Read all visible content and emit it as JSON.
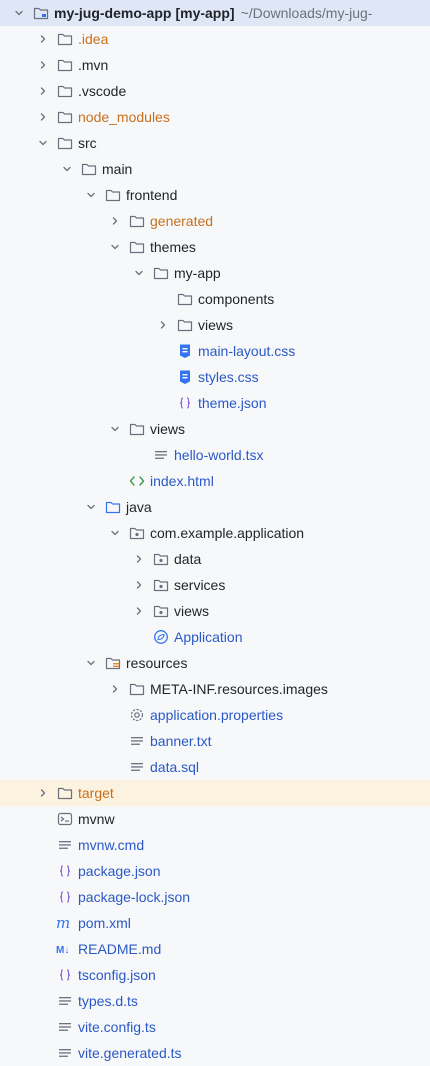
{
  "tree": {
    "rows": [
      {
        "label": "my-jug-demo-app",
        "tag": "[my-app]",
        "path": "~/Downloads/my-jug-",
        "kind": "module",
        "color": "dark",
        "depth": 0,
        "expand": "open",
        "selected": true
      },
      {
        "label": ".idea",
        "kind": "folder",
        "color": "orange",
        "depth": 1,
        "expand": "closed"
      },
      {
        "label": ".mvn",
        "kind": "folder",
        "color": "dark",
        "depth": 1,
        "expand": "closed"
      },
      {
        "label": ".vscode",
        "kind": "folder",
        "color": "dark",
        "depth": 1,
        "expand": "closed"
      },
      {
        "label": "node_modules",
        "kind": "folder",
        "color": "orange",
        "depth": 1,
        "expand": "closed"
      },
      {
        "label": "src",
        "kind": "folder",
        "color": "dark",
        "depth": 1,
        "expand": "open"
      },
      {
        "label": "main",
        "kind": "folder",
        "color": "dark",
        "depth": 2,
        "expand": "open"
      },
      {
        "label": "frontend",
        "kind": "folder",
        "color": "dark",
        "depth": 3,
        "expand": "open"
      },
      {
        "label": "generated",
        "kind": "folder",
        "color": "orange",
        "depth": 4,
        "expand": "closed"
      },
      {
        "label": "themes",
        "kind": "folder",
        "color": "dark",
        "depth": 4,
        "expand": "open"
      },
      {
        "label": "my-app",
        "kind": "folder",
        "color": "dark",
        "depth": 5,
        "expand": "open"
      },
      {
        "label": "components",
        "kind": "folder",
        "color": "dark",
        "depth": 6,
        "expand": "none"
      },
      {
        "label": "views",
        "kind": "folder",
        "color": "dark",
        "depth": 6,
        "expand": "closed"
      },
      {
        "label": "main-layout.css",
        "kind": "css",
        "color": "blue",
        "depth": 6,
        "expand": "none"
      },
      {
        "label": "styles.css",
        "kind": "css",
        "color": "blue",
        "depth": 6,
        "expand": "none"
      },
      {
        "label": "theme.json",
        "kind": "json",
        "color": "blue",
        "depth": 6,
        "expand": "none"
      },
      {
        "label": "views",
        "kind": "folder",
        "color": "dark",
        "depth": 4,
        "expand": "open"
      },
      {
        "label": "hello-world.tsx",
        "kind": "text",
        "color": "blue",
        "depth": 5,
        "expand": "none"
      },
      {
        "label": "index.html",
        "kind": "html",
        "color": "blue",
        "depth": 4,
        "expand": "none"
      },
      {
        "label": "java",
        "kind": "source-folder",
        "color": "dark",
        "depth": 3,
        "expand": "open"
      },
      {
        "label": "com.example.application",
        "kind": "package",
        "color": "dark",
        "depth": 4,
        "expand": "open"
      },
      {
        "label": "data",
        "kind": "package",
        "color": "dark",
        "depth": 5,
        "expand": "closed"
      },
      {
        "label": "services",
        "kind": "package",
        "color": "dark",
        "depth": 5,
        "expand": "closed"
      },
      {
        "label": "views",
        "kind": "package",
        "color": "dark",
        "depth": 5,
        "expand": "closed"
      },
      {
        "label": "Application",
        "kind": "spring",
        "color": "blue",
        "depth": 5,
        "expand": "none"
      },
      {
        "label": "resources",
        "kind": "resources",
        "color": "dark",
        "depth": 3,
        "expand": "open"
      },
      {
        "label": "META-INF.resources.images",
        "kind": "folder",
        "color": "dark",
        "depth": 4,
        "expand": "closed"
      },
      {
        "label": "application.properties",
        "kind": "properties",
        "color": "blue",
        "depth": 4,
        "expand": "none"
      },
      {
        "label": "banner.txt",
        "kind": "text",
        "color": "blue",
        "depth": 4,
        "expand": "none"
      },
      {
        "label": "data.sql",
        "kind": "text",
        "color": "blue",
        "depth": 4,
        "expand": "none"
      },
      {
        "label": "target",
        "kind": "folder",
        "color": "orange",
        "depth": 1,
        "expand": "closed",
        "highlight": true
      },
      {
        "label": "mvnw",
        "kind": "terminal",
        "color": "dark",
        "depth": 1,
        "expand": "none"
      },
      {
        "label": "mvnw.cmd",
        "kind": "text",
        "color": "blue",
        "depth": 1,
        "expand": "none"
      },
      {
        "label": "package.json",
        "kind": "json",
        "color": "blue",
        "depth": 1,
        "expand": "none"
      },
      {
        "label": "package-lock.json",
        "kind": "json",
        "color": "blue",
        "depth": 1,
        "expand": "none"
      },
      {
        "label": "pom.xml",
        "kind": "maven",
        "color": "blue",
        "depth": 1,
        "expand": "none"
      },
      {
        "label": "README.md",
        "kind": "markdown",
        "color": "blue",
        "depth": 1,
        "expand": "none"
      },
      {
        "label": "tsconfig.json",
        "kind": "json",
        "color": "blue",
        "depth": 1,
        "expand": "none"
      },
      {
        "label": "types.d.ts",
        "kind": "text",
        "color": "blue",
        "depth": 1,
        "expand": "none"
      },
      {
        "label": "vite.config.ts",
        "kind": "text",
        "color": "blue",
        "depth": 1,
        "expand": "none"
      },
      {
        "label": "vite.generated.ts",
        "kind": "text",
        "color": "blue",
        "depth": 1,
        "expand": "none"
      }
    ]
  }
}
